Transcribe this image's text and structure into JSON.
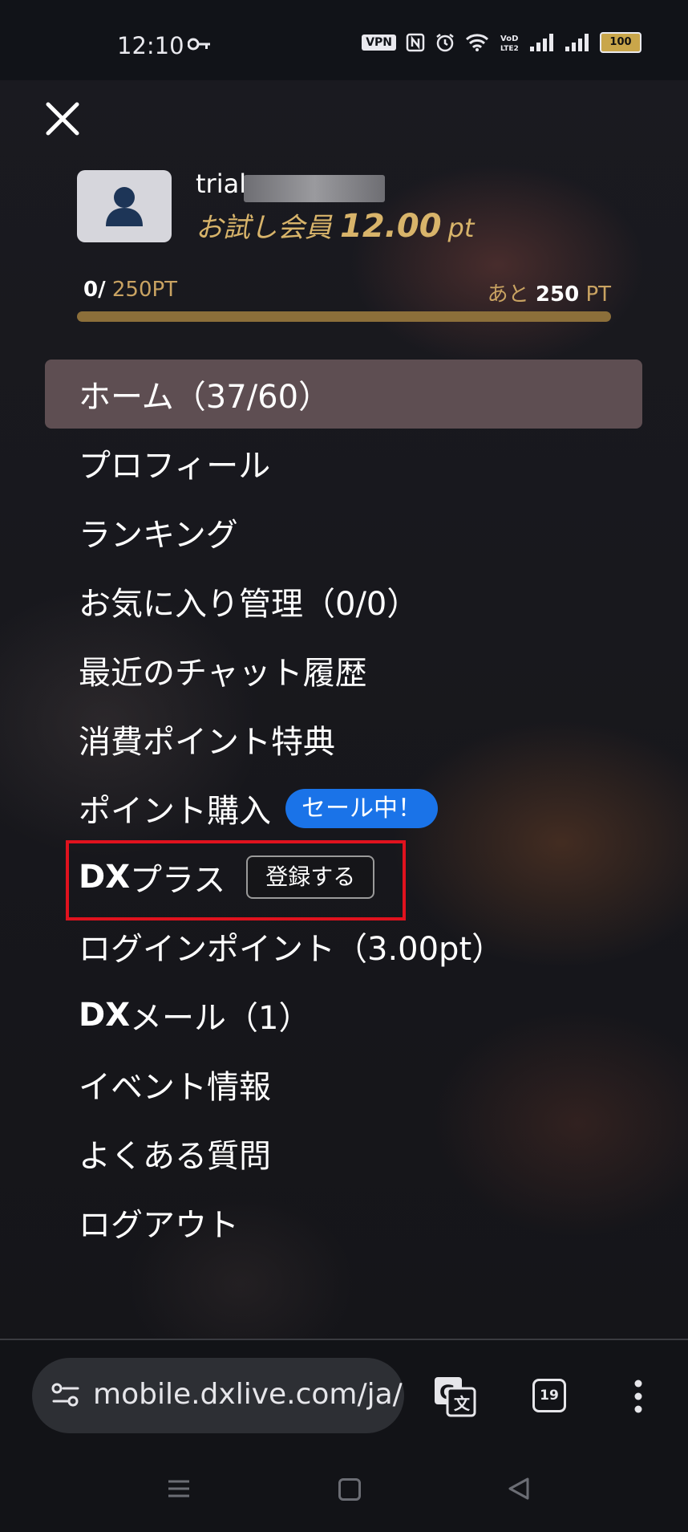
{
  "status_bar": {
    "time": "12:10",
    "vpn_label": "VPN",
    "battery": "100",
    "icons": [
      "key-icon",
      "vpn-icon",
      "nfc-icon",
      "alarm-icon",
      "wifi-icon",
      "volte-icon",
      "signal-icon",
      "signal-icon",
      "battery-icon"
    ]
  },
  "profile": {
    "username": "trial",
    "member_type": "お試し会員",
    "points": "12.00",
    "points_unit": "pt"
  },
  "progress": {
    "current": "0/",
    "max": "250PT",
    "remaining_prefix": "あと",
    "remaining_value": "250",
    "remaining_unit": "PT",
    "fill_fraction": 0
  },
  "menu": {
    "home": "ホーム（37/60）",
    "profile": "プロフィール",
    "ranking": "ランキング",
    "favorites": "お気に入り管理（0/0）",
    "recent_chat": "最近のチャット履歴",
    "consumption": "消費ポイント特典",
    "buy_points": "ポイント購入",
    "sale_badge": "セール中！",
    "dx_plus_bold": "DX",
    "dx_plus_rest": "プラス",
    "register_button": "登録する",
    "login_points": "ログインポイント（3.00pt）",
    "dx_mail_bold": "DX",
    "dx_mail_rest": "メール（1）",
    "events": "イベント情報",
    "faq": "よくある質問",
    "logout": "ログアウト"
  },
  "browser": {
    "url": "mobile.dxlive.com/ja/h",
    "tab_count": "19"
  },
  "colors": {
    "accent_gold": "#d8b46a",
    "sale_blue": "#1a73e8",
    "highlight_red": "#e0121e"
  }
}
